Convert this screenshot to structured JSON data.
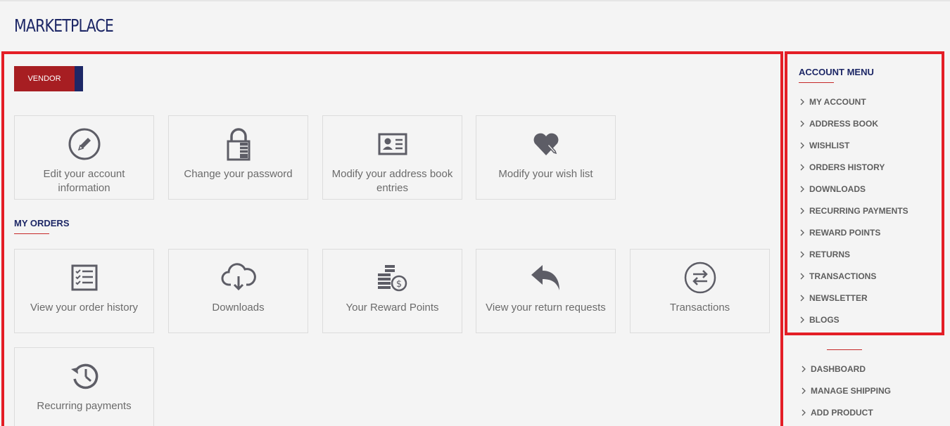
{
  "page": {
    "title": "MARKETPLACE"
  },
  "vendor_button": {
    "label": "VENDOR"
  },
  "account_tiles": [
    {
      "label": "Edit your account information",
      "icon": "pencil-circle-icon"
    },
    {
      "label": "Change your password",
      "icon": "lock-icon"
    },
    {
      "label": "Modify your address book entries",
      "icon": "address-card-icon"
    },
    {
      "label": "Modify your wish list",
      "icon": "heart-pen-icon"
    }
  ],
  "orders_section": {
    "title": "MY ORDERS"
  },
  "order_tiles": [
    {
      "label": "View your order history",
      "icon": "checklist-icon"
    },
    {
      "label": "Downloads",
      "icon": "cloud-download-icon"
    },
    {
      "label": "Your Reward Points",
      "icon": "coins-icon"
    },
    {
      "label": "View your return requests",
      "icon": "reply-arrow-icon"
    },
    {
      "label": "Transactions",
      "icon": "exchange-icon"
    },
    {
      "label": "Recurring payments",
      "icon": "history-icon"
    }
  ],
  "account_menu": {
    "title": "ACCOUNT MENU",
    "items": [
      "MY ACCOUNT",
      "ADDRESS BOOK",
      "WISHLIST",
      "ORDERS HISTORY",
      "DOWNLOADS",
      "RECURRING PAYMENTS",
      "REWARD POINTS",
      "RETURNS",
      "TRANSACTIONS",
      "NEWSLETTER",
      "BLOGS"
    ]
  },
  "vendor_menu": {
    "items": [
      "DASHBOARD",
      "MANAGE SHIPPING",
      "ADD PRODUCT"
    ]
  },
  "colors": {
    "accent_red": "#e41e26",
    "brand_navy": "#1d2766",
    "button_red": "#a71e22",
    "icon_gray": "#5d5d66"
  }
}
